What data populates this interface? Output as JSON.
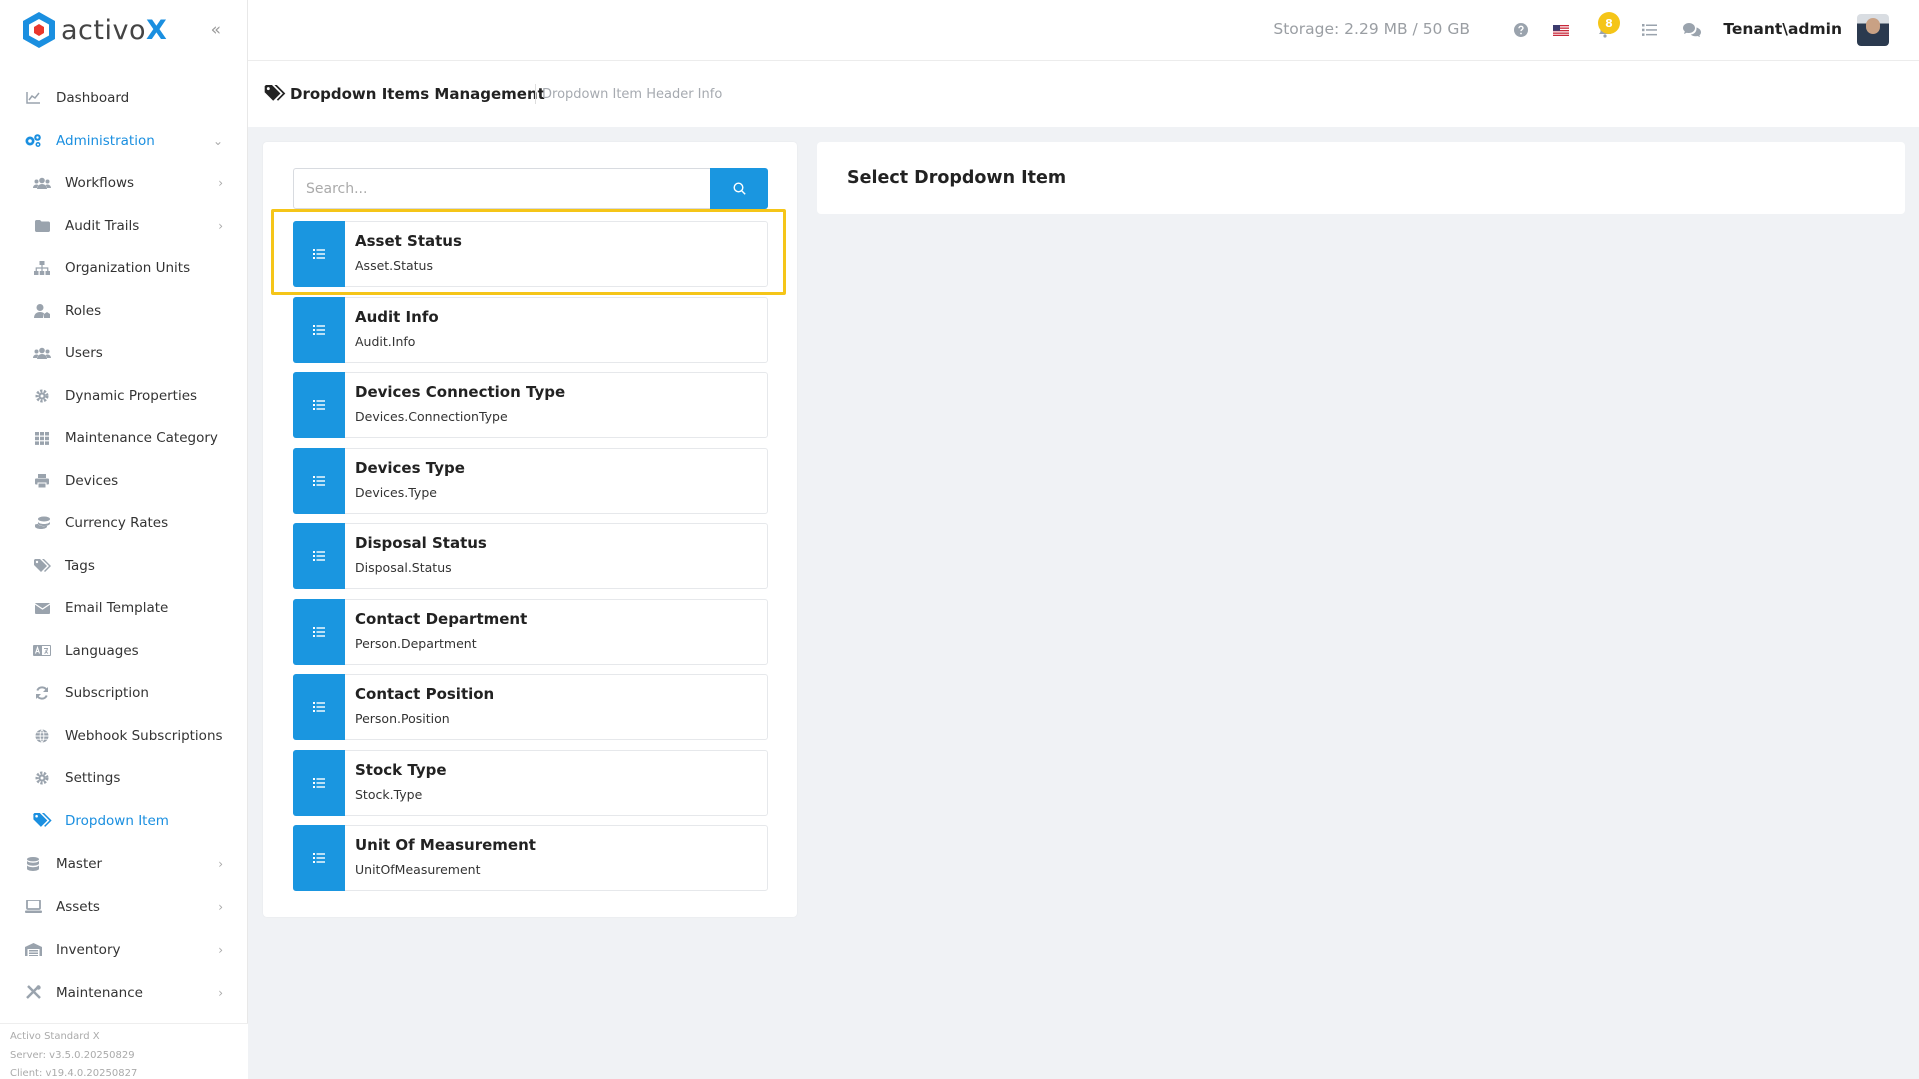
{
  "app": {
    "logo_prefix": "activo",
    "logo_suffix": "X"
  },
  "sidebar": {
    "items": [
      {
        "label": "Dashboard",
        "icon": "chart-line-icon"
      },
      {
        "label": "Administration",
        "icon": "cogs-icon",
        "active": true,
        "expanded": true
      },
      {
        "label": "Master",
        "icon": "database-icon"
      },
      {
        "label": "Assets",
        "icon": "laptop-icon"
      },
      {
        "label": "Inventory",
        "icon": "warehouse-icon"
      },
      {
        "label": "Maintenance",
        "icon": "tools-icon"
      }
    ],
    "admin_children": [
      {
        "label": "Workflows",
        "icon": "users-icon",
        "has_children": true
      },
      {
        "label": "Audit Trails",
        "icon": "folder-icon",
        "has_children": true
      },
      {
        "label": "Organization Units",
        "icon": "sitemap-icon"
      },
      {
        "label": "Roles",
        "icon": "user-tag-icon"
      },
      {
        "label": "Users",
        "icon": "users-icon"
      },
      {
        "label": "Dynamic Properties",
        "icon": "gear-icon"
      },
      {
        "label": "Maintenance Category",
        "icon": "grid-icon"
      },
      {
        "label": "Devices",
        "icon": "printer-icon"
      },
      {
        "label": "Currency Rates",
        "icon": "coins-icon"
      },
      {
        "label": "Tags",
        "icon": "tags-icon"
      },
      {
        "label": "Email Template",
        "icon": "envelope-icon"
      },
      {
        "label": "Languages",
        "icon": "language-icon"
      },
      {
        "label": "Subscription",
        "icon": "sync-icon"
      },
      {
        "label": "Webhook Subscriptions",
        "icon": "globe-icon"
      },
      {
        "label": "Settings",
        "icon": "gear-icon"
      },
      {
        "label": "Dropdown Item",
        "icon": "tags-icon",
        "active": true
      }
    ],
    "version": {
      "product": "Activo Standard X",
      "server": "Server: v3.5.0.20250829",
      "client": "Client: v19.4.0.20250827"
    }
  },
  "topbar": {
    "storage": "Storage: 2.29 MB / 50 GB",
    "notification_count": "8",
    "user": "Tenant\\admin"
  },
  "subheader": {
    "title": "Dropdown Items Management",
    "subtitle": "Dropdown Item Header Info"
  },
  "search": {
    "placeholder": "Search...",
    "value": ""
  },
  "dropdown_items": [
    {
      "title": "Asset Status",
      "code": "Asset.Status"
    },
    {
      "title": "Audit Info",
      "code": "Audit.Info"
    },
    {
      "title": "Devices Connection Type",
      "code": "Devices.ConnectionType"
    },
    {
      "title": "Devices Type",
      "code": "Devices.Type"
    },
    {
      "title": "Disposal Status",
      "code": "Disposal.Status"
    },
    {
      "title": "Contact Department",
      "code": "Person.Department"
    },
    {
      "title": "Contact Position",
      "code": "Person.Position"
    },
    {
      "title": "Stock Type",
      "code": "Stock.Type"
    },
    {
      "title": "Unit Of Measurement",
      "code": "UnitOfMeasurement"
    }
  ],
  "detail": {
    "title": "Select Dropdown Item"
  },
  "colors": {
    "accent": "#1a96e0",
    "highlight": "#f5c518",
    "badge": "#f5c518"
  }
}
